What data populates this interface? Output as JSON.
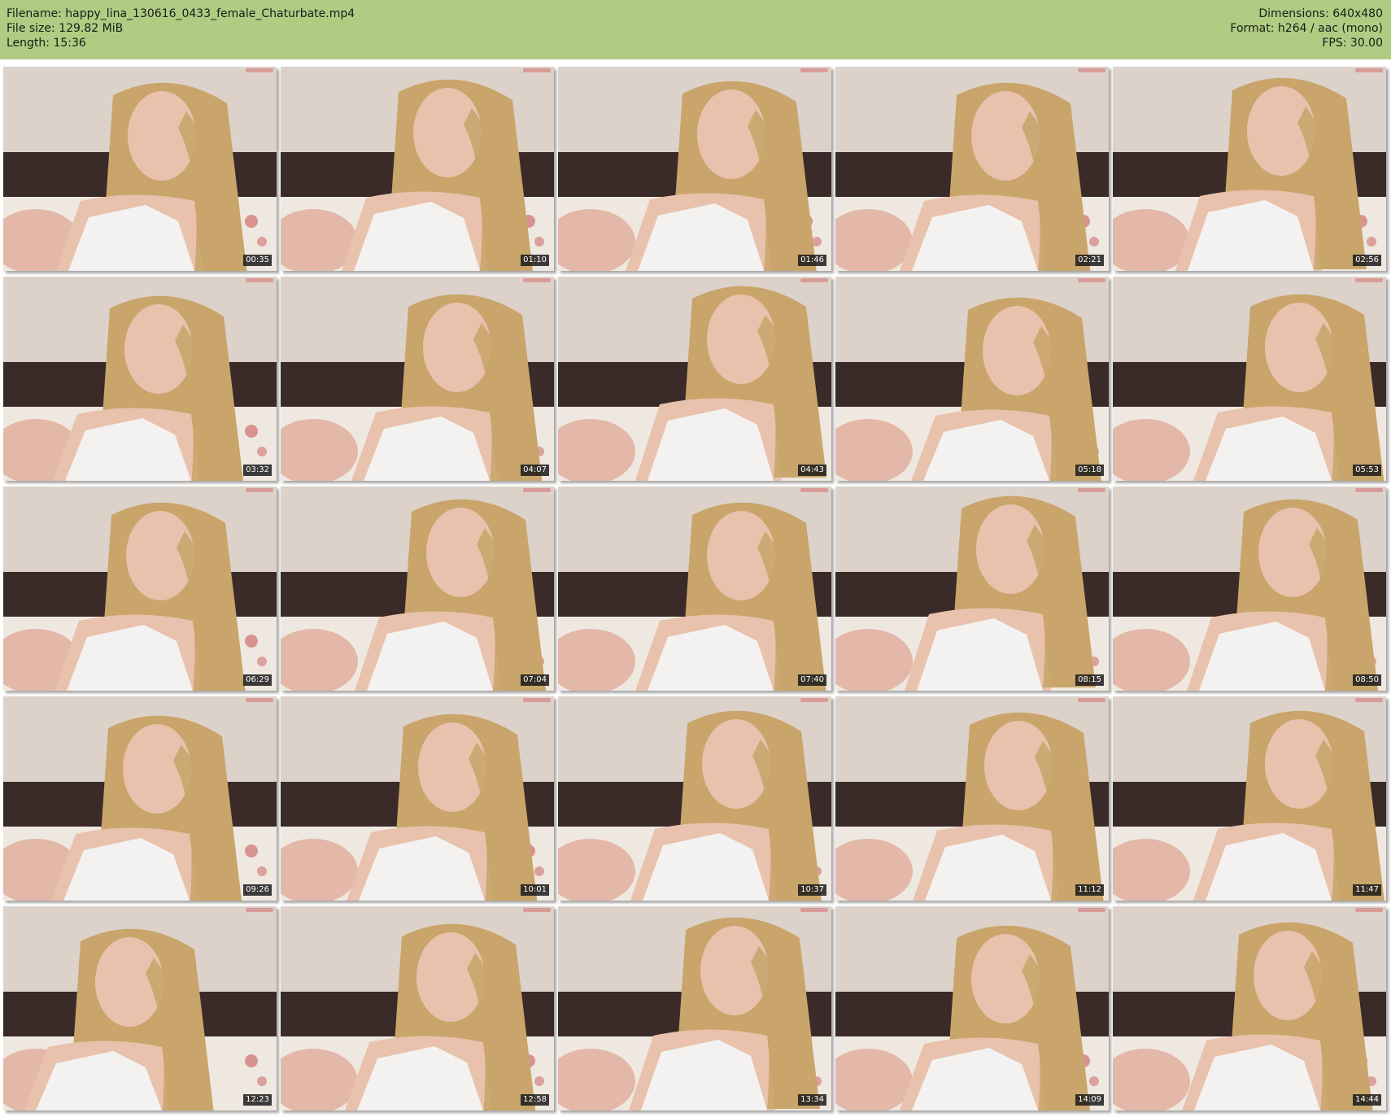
{
  "header": {
    "filename": "Filename: happy_lina_130616_0433_female_Chaturbate.mp4",
    "file_size": "File size: 129.82 MiB",
    "length": "Length: 15:36",
    "dimensions": "Dimensions: 640x480",
    "format": "Format: h264 / aac (mono)",
    "fps": "FPS: 30.00"
  },
  "thumbnails": [
    {
      "time": "00:35"
    },
    {
      "time": "01:10"
    },
    {
      "time": "01:46"
    },
    {
      "time": "02:21"
    },
    {
      "time": "02:56"
    },
    {
      "time": "03:32"
    },
    {
      "time": "04:07"
    },
    {
      "time": "04:43"
    },
    {
      "time": "05:18"
    },
    {
      "time": "05:53"
    },
    {
      "time": "06:29"
    },
    {
      "time": "07:04"
    },
    {
      "time": "07:40"
    },
    {
      "time": "08:15"
    },
    {
      "time": "08:50"
    },
    {
      "time": "09:26"
    },
    {
      "time": "10:01"
    },
    {
      "time": "10:37"
    },
    {
      "time": "11:12"
    },
    {
      "time": "11:47"
    },
    {
      "time": "12:23"
    },
    {
      "time": "12:58"
    },
    {
      "time": "13:34"
    },
    {
      "time": "14:09"
    },
    {
      "time": "14:44"
    }
  ],
  "colors": {
    "header_bg": "#aecd82",
    "wall": "#dcd2ca",
    "headboard": "#3a2a28",
    "hair": "#c9a56b",
    "skin": "#e8c2ad",
    "top": "#f4f2f0",
    "pillow": "#efe8e0"
  }
}
